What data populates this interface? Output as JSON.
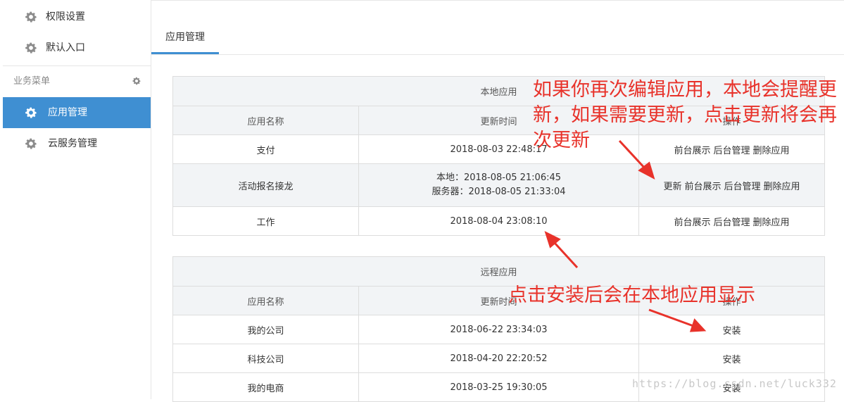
{
  "sidebar": {
    "items": [
      {
        "label": "权限设置",
        "icon": "gear-icon"
      },
      {
        "label": "默认入口",
        "icon": "gear-icon"
      }
    ],
    "section": {
      "title": "业务菜单",
      "icon": "cog-icon"
    },
    "menu": [
      {
        "label": "应用管理",
        "icon": "gear-icon",
        "active": true
      },
      {
        "label": "云服务管理",
        "icon": "gear-icon",
        "active": false
      }
    ]
  },
  "tabs": [
    {
      "label": "应用管理",
      "active": true
    }
  ],
  "local_table": {
    "caption": "本地应用",
    "headers": [
      "应用名称",
      "更新时间",
      "操作"
    ],
    "rows": [
      {
        "name": "支付",
        "time": "2018-08-03 22:48:17",
        "actions": [
          "前台展示",
          "后台管理",
          "删除应用"
        ]
      },
      {
        "name": "活动报名接龙",
        "time": "本地：2018-08-05 21:06:45",
        "time2": "服务器：2018-08-05 21:33:04",
        "actions": [
          "更新",
          "前台展示",
          "后台管理",
          "删除应用"
        ]
      },
      {
        "name": "工作",
        "time": "2018-08-04 23:08:10",
        "actions": [
          "前台展示",
          "后台管理",
          "删除应用"
        ]
      }
    ]
  },
  "remote_table": {
    "caption": "远程应用",
    "headers": [
      "应用名称",
      "更新时间",
      "操作"
    ],
    "rows": [
      {
        "name": "我的公司",
        "time": "2018-06-22 23:34:03",
        "action": "安装"
      },
      {
        "name": "科技公司",
        "time": "2018-04-20 22:20:52",
        "action": "安装"
      },
      {
        "name": "我的电商",
        "time": "2018-03-25 19:30:05",
        "action": "安装"
      }
    ]
  },
  "annotations": {
    "note1": "如果你再次编辑应用，本地会提醒更新，如果需要更新，点击更新将会再次更新",
    "note2": "点击安装后会在本地应用显示",
    "color": "#e8322a"
  },
  "watermark": "https://blog.csdn.net/luck332",
  "colors": {
    "accent": "#3f8fd2",
    "header_bg": "#f2f4f6",
    "border": "#dddddd"
  }
}
